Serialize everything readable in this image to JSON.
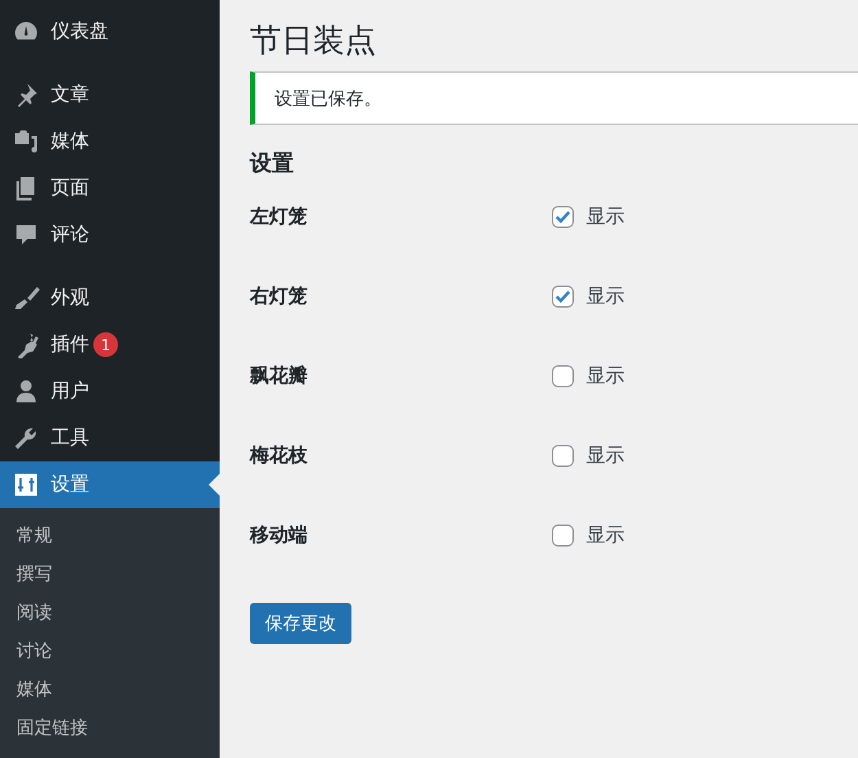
{
  "sidebar": {
    "groups": [
      {
        "items": [
          {
            "label": "仪表盘",
            "selected": false
          }
        ]
      },
      {
        "items": [
          {
            "label": "文章",
            "selected": false
          },
          {
            "label": "媒体",
            "selected": false
          },
          {
            "label": "页面",
            "selected": false
          },
          {
            "label": "评论",
            "selected": false
          }
        ]
      },
      {
        "items": [
          {
            "label": "外观",
            "selected": false
          },
          {
            "label": "插件",
            "selected": false,
            "badge": "1"
          },
          {
            "label": "用户",
            "selected": false
          },
          {
            "label": "工具",
            "selected": false
          },
          {
            "label": "设置",
            "selected": true
          }
        ]
      }
    ],
    "submenu": [
      "常规",
      "撰写",
      "阅读",
      "讨论",
      "媒体",
      "固定链接"
    ]
  },
  "page": {
    "title": "节日装点",
    "notice": "设置已保存。",
    "section_title": "设置",
    "options": [
      {
        "label": "左灯笼",
        "checkbox_label": "显示",
        "checked": true
      },
      {
        "label": "右灯笼",
        "checkbox_label": "显示",
        "checked": true
      },
      {
        "label": "飘花瓣",
        "checkbox_label": "显示",
        "checked": false
      },
      {
        "label": "梅花枝",
        "checkbox_label": "显示",
        "checked": false
      },
      {
        "label": "移动端",
        "checkbox_label": "显示",
        "checked": false
      }
    ],
    "save_button": "保存更改"
  }
}
